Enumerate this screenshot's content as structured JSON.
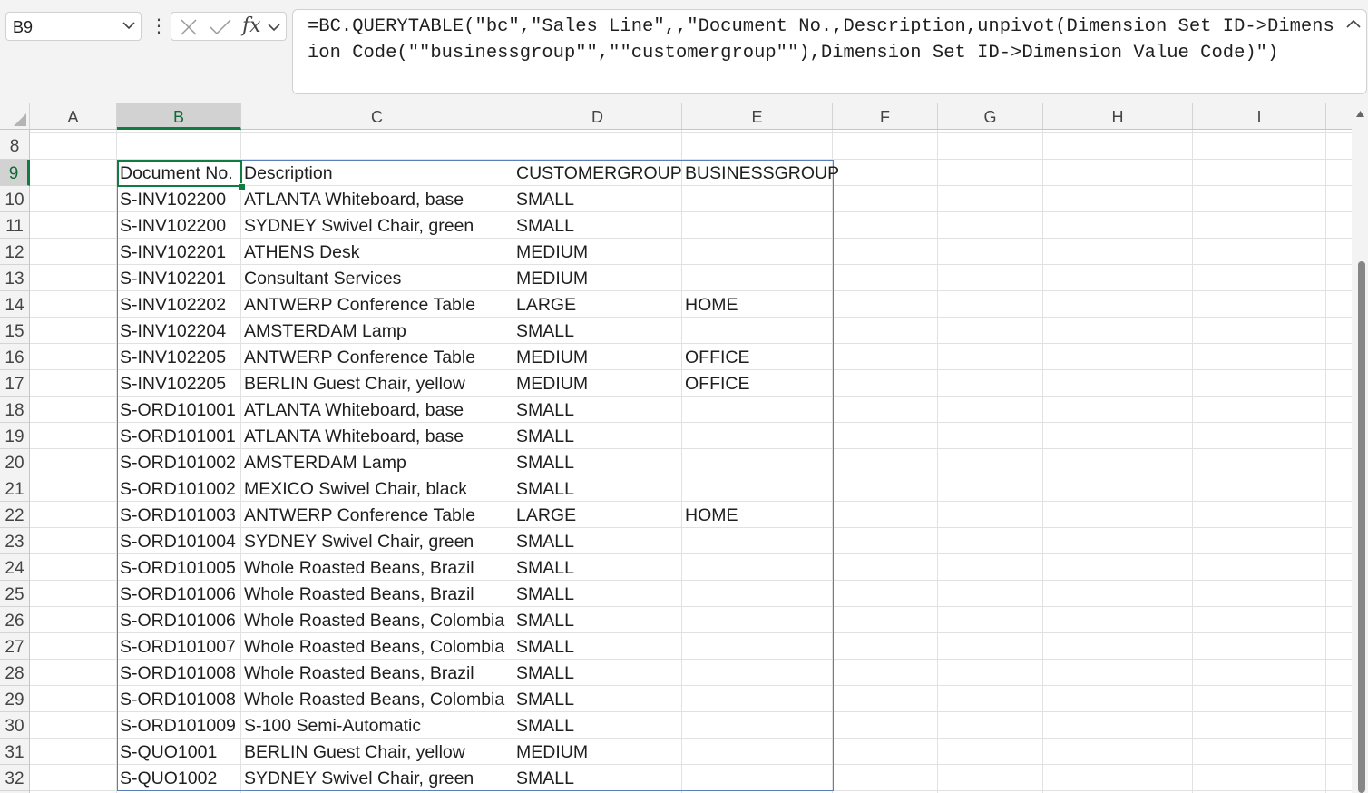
{
  "name_box": {
    "value": "B9",
    "chevron_icon": "chevron-down-icon"
  },
  "formula_bar": {
    "more_icon": "vertical-ellipsis-icon",
    "cancel_icon": "x-icon",
    "enter_icon": "checkmark-icon",
    "fx_label": "fx",
    "formula": "=BC.QUERYTABLE(\"bc\",\"Sales Line\",,\"Document No.,Description,unpivot(Dimension Set ID->Dimension Code(\"\"businessgroup\"\",\"\"customergroup\"\"),Dimension Set ID->Dimension Value Code)\")",
    "collapse_icon": "chevron-up-icon"
  },
  "columns": [
    "A",
    "B",
    "C",
    "D",
    "E",
    "F",
    "G",
    "H",
    "I"
  ],
  "selected_column": "B",
  "selected_row": "9",
  "row_numbers": [
    "8",
    "9",
    "10",
    "11",
    "12",
    "13",
    "14",
    "15",
    "16",
    "17",
    "18",
    "19",
    "20",
    "21",
    "22",
    "23",
    "24",
    "25",
    "26",
    "27",
    "28",
    "29",
    "30",
    "31",
    "32"
  ],
  "table": {
    "headers": [
      "Document No.",
      "Description",
      "CUSTOMERGROUP",
      "BUSINESSGROUP"
    ],
    "rows": [
      [
        "S-INV102200",
        "ATLANTA Whiteboard, base",
        "SMALL",
        ""
      ],
      [
        "S-INV102200",
        "SYDNEY Swivel Chair, green",
        "SMALL",
        ""
      ],
      [
        "S-INV102201",
        "ATHENS Desk",
        "MEDIUM",
        ""
      ],
      [
        "S-INV102201",
        "Consultant Services",
        "MEDIUM",
        ""
      ],
      [
        "S-INV102202",
        "ANTWERP Conference Table",
        "LARGE",
        "HOME"
      ],
      [
        "S-INV102204",
        "AMSTERDAM Lamp",
        "SMALL",
        ""
      ],
      [
        "S-INV102205",
        "ANTWERP Conference Table",
        "MEDIUM",
        "OFFICE"
      ],
      [
        "S-INV102205",
        "BERLIN Guest Chair, yellow",
        "MEDIUM",
        "OFFICE"
      ],
      [
        "S-ORD101001",
        "ATLANTA Whiteboard, base",
        "SMALL",
        ""
      ],
      [
        "S-ORD101001",
        "ATLANTA Whiteboard, base",
        "SMALL",
        ""
      ],
      [
        "S-ORD101002",
        "AMSTERDAM Lamp",
        "SMALL",
        ""
      ],
      [
        "S-ORD101002",
        "MEXICO Swivel Chair, black",
        "SMALL",
        ""
      ],
      [
        "S-ORD101003",
        "ANTWERP Conference Table",
        "LARGE",
        "HOME"
      ],
      [
        "S-ORD101004",
        "SYDNEY Swivel Chair, green",
        "SMALL",
        ""
      ],
      [
        "S-ORD101005",
        "Whole Roasted Beans, Brazil",
        "SMALL",
        ""
      ],
      [
        "S-ORD101006",
        "Whole Roasted Beans, Brazil",
        "SMALL",
        ""
      ],
      [
        "S-ORD101006",
        "Whole Roasted Beans, Colombia",
        "SMALL",
        ""
      ],
      [
        "S-ORD101007",
        "Whole Roasted Beans, Colombia",
        "SMALL",
        ""
      ],
      [
        "S-ORD101008",
        "Whole Roasted Beans, Brazil",
        "SMALL",
        ""
      ],
      [
        "S-ORD101008",
        "Whole Roasted Beans, Colombia",
        "SMALL",
        ""
      ],
      [
        "S-ORD101009",
        "S-100 Semi-Automatic",
        "SMALL",
        ""
      ],
      [
        "S-QUO1001",
        "BERLIN Guest Chair, yellow",
        "MEDIUM",
        ""
      ],
      [
        "S-QUO1002",
        "SYDNEY Swivel Chair, green",
        "SMALL",
        ""
      ]
    ]
  },
  "colors": {
    "selection_green": "#107c41",
    "table_border": "#5b80b7"
  }
}
